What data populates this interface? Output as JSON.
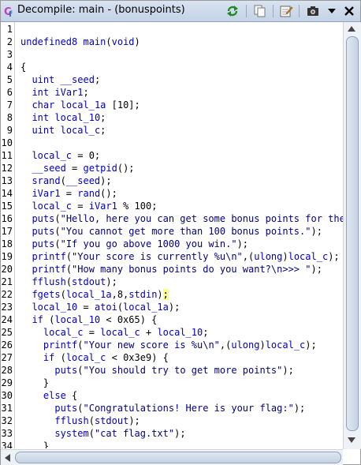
{
  "window": {
    "title": "Decompile: main -  (bonuspoints)",
    "toolbar": [
      {
        "name": "refresh-icon"
      },
      {
        "name": "copy-icon"
      },
      {
        "name": "edit-icon"
      },
      {
        "name": "snapshot-icon"
      },
      {
        "name": "menu-down-icon"
      },
      {
        "name": "close-icon"
      }
    ]
  },
  "code": {
    "line_numbers": [
      "1",
      "2",
      "3",
      "4",
      "5",
      "6",
      "7",
      "8",
      "9",
      "10",
      "11",
      "12",
      "13",
      "14",
      "15",
      "16",
      "17",
      "18",
      "19",
      "20",
      "21",
      "22",
      "23",
      "24",
      "25",
      "26",
      "27",
      "28",
      "29",
      "30",
      "31",
      "32",
      "33",
      "34"
    ],
    "lines": [
      "",
      "undefined8 main(void)",
      "",
      "{",
      "  uint __seed;",
      "  int iVar1;",
      "  char local_1a [10];",
      "  int local_10;",
      "  uint local_c;",
      "",
      "  local_c = 0;",
      "  __seed = getpid();",
      "  srand(__seed);",
      "  iVar1 = rand();",
      "  local_c = iVar1 % 100;",
      "  puts(\"Hello, here you can get some bonus points for the c",
      "  puts(\"You cannot get more than 100 bonus points.\");",
      "  puts(\"If you go above 1000 you win.\");",
      "  printf(\"Your score is currently %u\\n\",(ulong)local_c);",
      "  printf(\"How many bonus points do you want?\\n>>> \");",
      "  fflush(stdout);",
      "  fgets(local_1a,8,stdin);",
      "  local_10 = atoi(local_1a);",
      "  if (local_10 < 0x65) {",
      "    local_c = local_c + local_10;",
      "    printf(\"Your new score is %u\\n\",(ulong)local_c);",
      "    if (local_c < 0x3e9) {",
      "      puts(\"You should try to get more points\");",
      "    }",
      "    else {",
      "      puts(\"Congratulations! Here is your flag:\");",
      "      fflush(stdout);",
      "      system(\"cat flag.txt\");",
      "    }"
    ]
  }
}
